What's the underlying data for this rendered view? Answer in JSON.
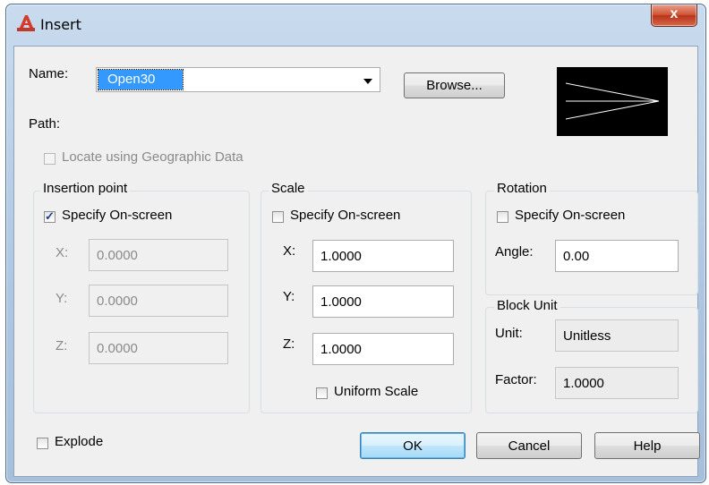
{
  "window": {
    "title": "Insert",
    "close_label": "x",
    "app_icon": "autocad-a-icon"
  },
  "name": {
    "label": "Name:",
    "value": "Open30",
    "browse_label": "Browse..."
  },
  "path": {
    "label": "Path:"
  },
  "locate": {
    "label": "Locate using Geographic Data",
    "checked": false,
    "enabled": false
  },
  "insertion": {
    "title": "Insertion point",
    "specify_label": "Specify On-screen",
    "specify_checked": true,
    "x_label": "X:",
    "x_value": "0.0000",
    "y_label": "Y:",
    "y_value": "0.0000",
    "z_label": "Z:",
    "z_value": "0.0000"
  },
  "scale": {
    "title": "Scale",
    "specify_label": "Specify On-screen",
    "specify_checked": false,
    "x_label": "X:",
    "x_value": "1.0000",
    "y_label": "Y:",
    "y_value": "1.0000",
    "z_label": "Z:",
    "z_value": "1.0000",
    "uniform_label": "Uniform Scale",
    "uniform_checked": false
  },
  "rotation": {
    "title": "Rotation",
    "specify_label": "Specify On-screen",
    "specify_checked": false,
    "angle_label": "Angle:",
    "angle_value": "0.00"
  },
  "block_unit": {
    "title": "Block Unit",
    "unit_label": "Unit:",
    "unit_value": "Unitless",
    "factor_label": "Factor:",
    "factor_value": "1.0000"
  },
  "explode": {
    "label": "Explode",
    "checked": false
  },
  "buttons": {
    "ok": "OK",
    "cancel": "Cancel",
    "help": "Help"
  },
  "colors": {
    "selection": "#3399ff",
    "dialog_bg": "#f0f0f0",
    "preview_bg": "#000000",
    "close": "#c8452a"
  }
}
